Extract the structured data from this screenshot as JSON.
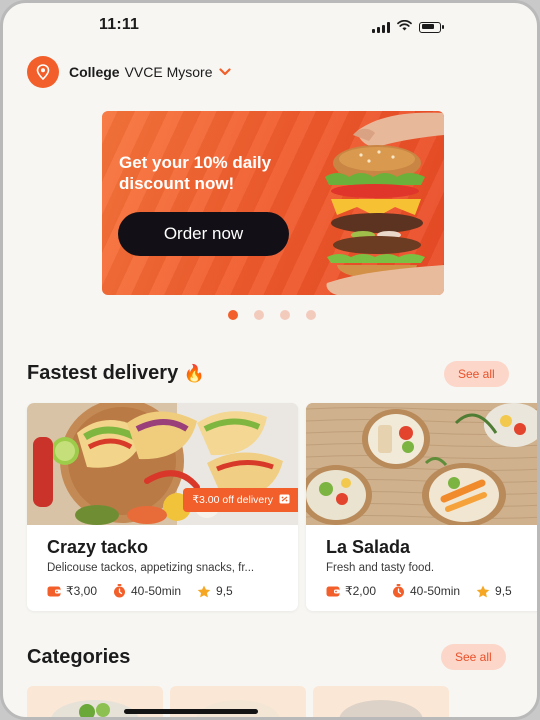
{
  "status_bar": {
    "time": "11:11"
  },
  "location": {
    "type": "College",
    "name": "VVCE Mysore"
  },
  "banner": {
    "headline": "Get your 10% daily discount now!",
    "cta": "Order now"
  },
  "carousel": {
    "count": 4,
    "active_index": 0
  },
  "fastest_delivery": {
    "title": "Fastest delivery",
    "emoji": "🔥",
    "see_all": "See all",
    "restaurants": [
      {
        "name": "Crazy tacko",
        "description": "Delicouse tackos, appetizing snacks, fr...",
        "delivery_fee": "₹3,00",
        "time": "40-50min",
        "rating": "9,5",
        "promo": "₹3.00 off delivery"
      },
      {
        "name": "La Salada",
        "description": "Fresh and tasty food.",
        "delivery_fee": "₹2,00",
        "time": "40-50min",
        "rating": "9,5"
      }
    ]
  },
  "categories": {
    "title": "Categories",
    "see_all": "See all"
  },
  "colors": {
    "accent": "#f25f2a",
    "accent_soft": "#fcd6c8",
    "button_dark": "#121016",
    "background": "#f7f6f3"
  },
  "icons": [
    "location-pin-icon",
    "chevron-down-icon",
    "wallet-icon",
    "timer-icon",
    "star-icon",
    "ticket-icon",
    "fire-icon"
  ]
}
